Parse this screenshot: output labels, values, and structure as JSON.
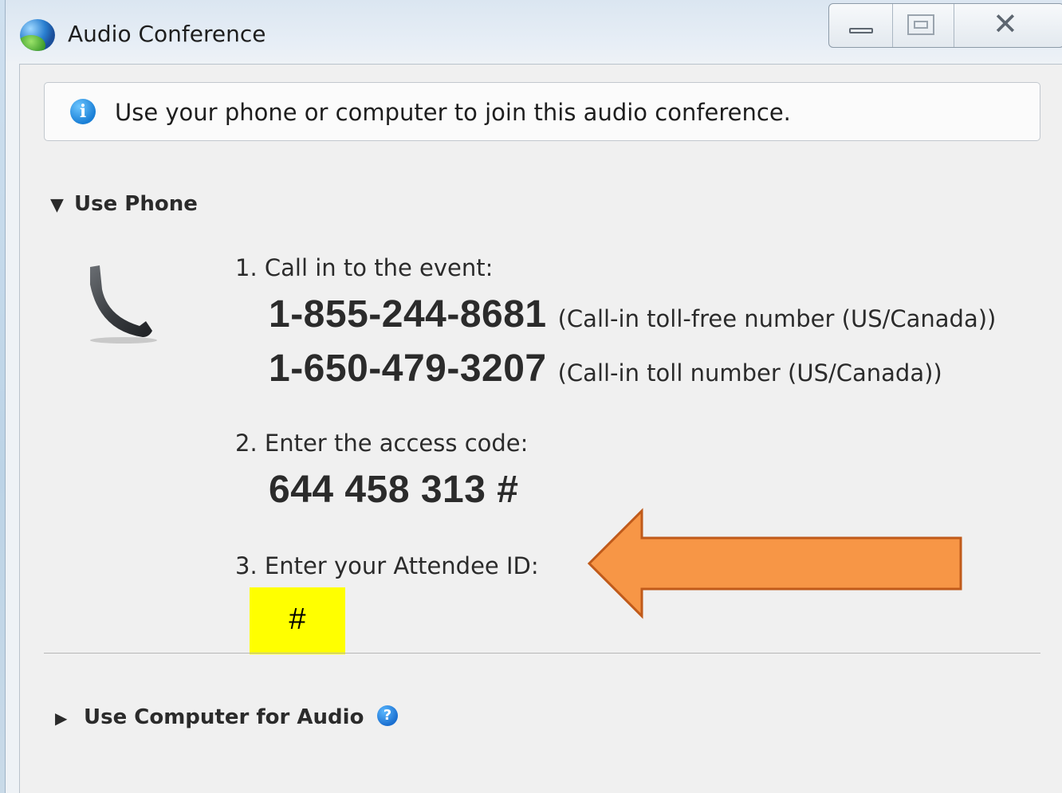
{
  "window": {
    "title": "Audio Conference",
    "controls": {
      "minimize": "minimize",
      "maximize": "maximize",
      "close": "close"
    }
  },
  "info": {
    "icon": "info-icon",
    "text": "Use your phone or computer to join this audio conference."
  },
  "use_phone": {
    "header": "Use Phone",
    "expanded": true,
    "icon": "phone-handset-icon",
    "steps": {
      "call_in": {
        "label": "1. Call in to the event:",
        "numbers": [
          {
            "number": "1-855-244-8681",
            "description": "(Call-in toll-free number (US/Canada))"
          },
          {
            "number": "1-650-479-3207",
            "description": "(Call-in toll number (US/Canada))"
          }
        ]
      },
      "access_code": {
        "label": "2. Enter the access code:",
        "code": "644 458 313 #"
      },
      "attendee_id": {
        "label": "3. Enter your Attendee ID:",
        "value": "#"
      }
    }
  },
  "use_computer": {
    "header": "Use Computer for Audio",
    "expanded": false,
    "help_icon": "help-icon"
  },
  "annotation": {
    "arrow_color": "#f79646",
    "arrow_stroke": "#c05a1a",
    "highlight_color": "#ffff00"
  }
}
